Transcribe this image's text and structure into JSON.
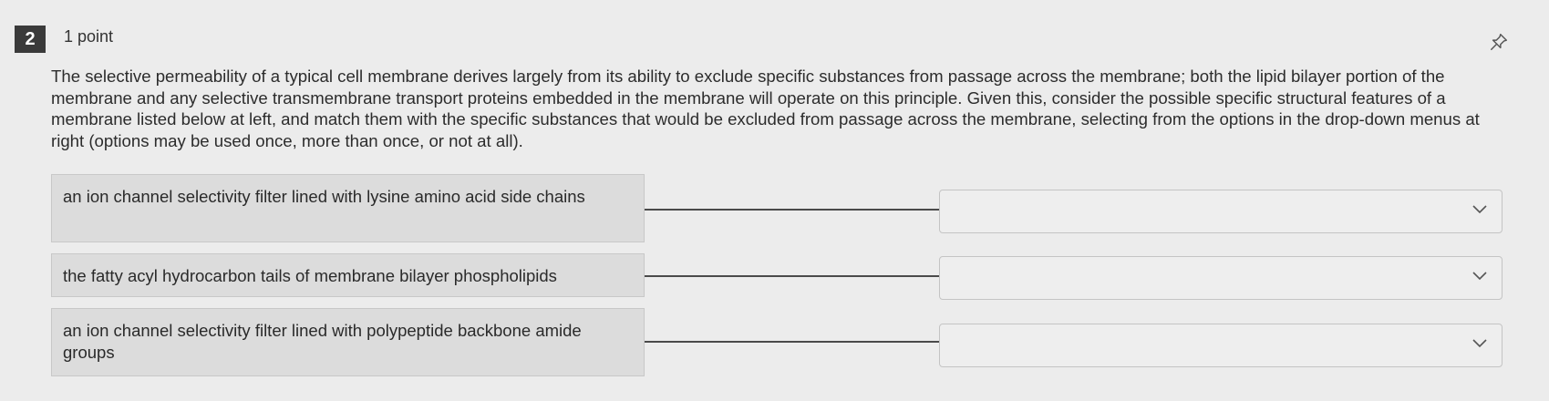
{
  "question": {
    "number": "2",
    "points": "1 point",
    "prompt": "The selective permeability of a typical cell membrane derives largely from its ability to exclude specific substances from passage across the membrane; both the lipid bilayer portion of the membrane and any selective transmembrane transport proteins embedded in the membrane will operate on this principle. Given this, consider the possible specific structural features of a membrane listed below at left, and match them with the specific substances that would be excluded from passage across the membrane, selecting from the options in the drop-down menus at right (options may be used once, more than once, or not at all)."
  },
  "items": [
    {
      "label": "an ion channel selectivity filter lined with lysine amino acid side chains",
      "selected": ""
    },
    {
      "label": "the fatty acyl hydrocarbon tails of membrane bilayer phospholipids",
      "selected": ""
    },
    {
      "label": "an ion channel selectivity filter lined with polypeptide backbone amide groups",
      "selected": ""
    }
  ],
  "icons": {
    "pin": "pin-icon",
    "dropdown": "chevron-down-icon"
  },
  "colors": {
    "badge": "#3a3a3a",
    "feature_bg": "#dcdcdc",
    "page_bg": "#ececec"
  }
}
